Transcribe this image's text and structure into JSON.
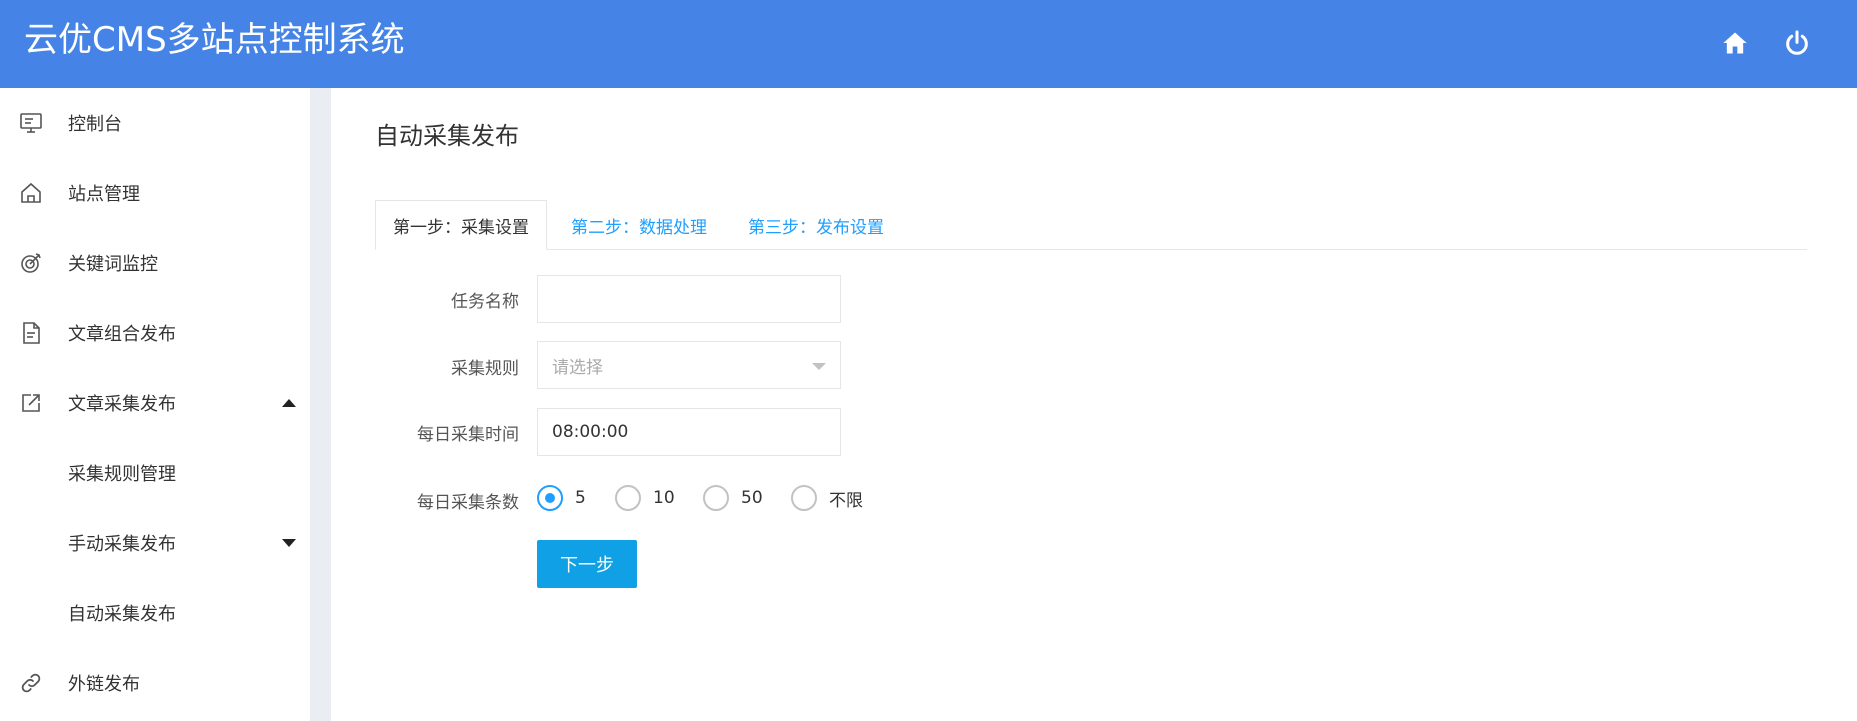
{
  "header": {
    "title": "云优CMS多站点控制系统",
    "icons": [
      "home-icon",
      "power-icon"
    ],
    "background": "#4584e6"
  },
  "sidebar": {
    "items": [
      {
        "label": "控制台",
        "icon": "monitor-icon"
      },
      {
        "label": "站点管理",
        "icon": "home-outline-icon"
      },
      {
        "label": "关键词监控",
        "icon": "target-icon"
      },
      {
        "label": "文章组合发布",
        "icon": "document-icon"
      },
      {
        "label": "文章采集发布",
        "icon": "external-link-icon",
        "expanded": true
      },
      {
        "label": "采集规则管理"
      },
      {
        "label": "手动采集发布",
        "expanded": false
      },
      {
        "label": "自动采集发布"
      },
      {
        "label": "外链发布",
        "icon": "link-icon"
      }
    ]
  },
  "main": {
    "page_title": "自动采集发布",
    "tabs": [
      {
        "label": "第一步：采集设置",
        "active": true
      },
      {
        "label": "第二步：数据处理",
        "active": false
      },
      {
        "label": "第三步：发布设置",
        "active": false
      }
    ],
    "form": {
      "task_name": {
        "label": "任务名称",
        "value": ""
      },
      "rule": {
        "label": "采集规则",
        "placeholder": "请选择"
      },
      "daily_time": {
        "label": "每日采集时间",
        "value": "08:00:00"
      },
      "daily_count": {
        "label": "每日采集条数",
        "options": [
          "5",
          "10",
          "50",
          "不限"
        ],
        "selected": "5"
      },
      "next_button": "下一步"
    },
    "accent_color": "#1e9fff",
    "button_color": "#0fa0e6"
  }
}
